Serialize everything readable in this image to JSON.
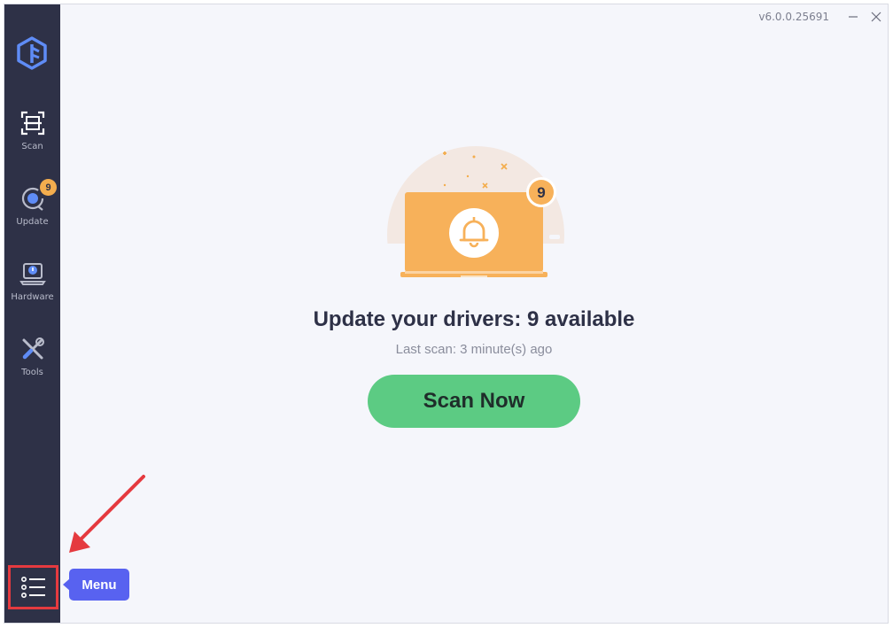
{
  "app": {
    "version": "v6.0.0.25691"
  },
  "colors": {
    "sidebar": "#2e3147",
    "accent": "#5ccb83",
    "badge": "#f3ad4e",
    "tooltip": "#5862f0",
    "highlight": "#e53a3f"
  },
  "sidebar": {
    "logo_icon": "driver-easy-logo-icon",
    "items": [
      {
        "label": "Scan",
        "icon": "scan-icon"
      },
      {
        "label": "Update",
        "icon": "update-icon",
        "badge": "9"
      },
      {
        "label": "Hardware",
        "icon": "hardware-icon"
      },
      {
        "label": "Tools",
        "icon": "tools-icon"
      }
    ],
    "menu_icon": "menu-list-icon"
  },
  "window_controls": {
    "minimize_icon": "minimize-icon",
    "close_icon": "close-icon"
  },
  "main": {
    "hero_badge": "9",
    "headline": "Update your drivers: 9 available",
    "last_scan": "Last scan: 3 minute(s) ago",
    "scan_button": "Scan Now"
  },
  "tooltip": {
    "label": "Menu"
  }
}
